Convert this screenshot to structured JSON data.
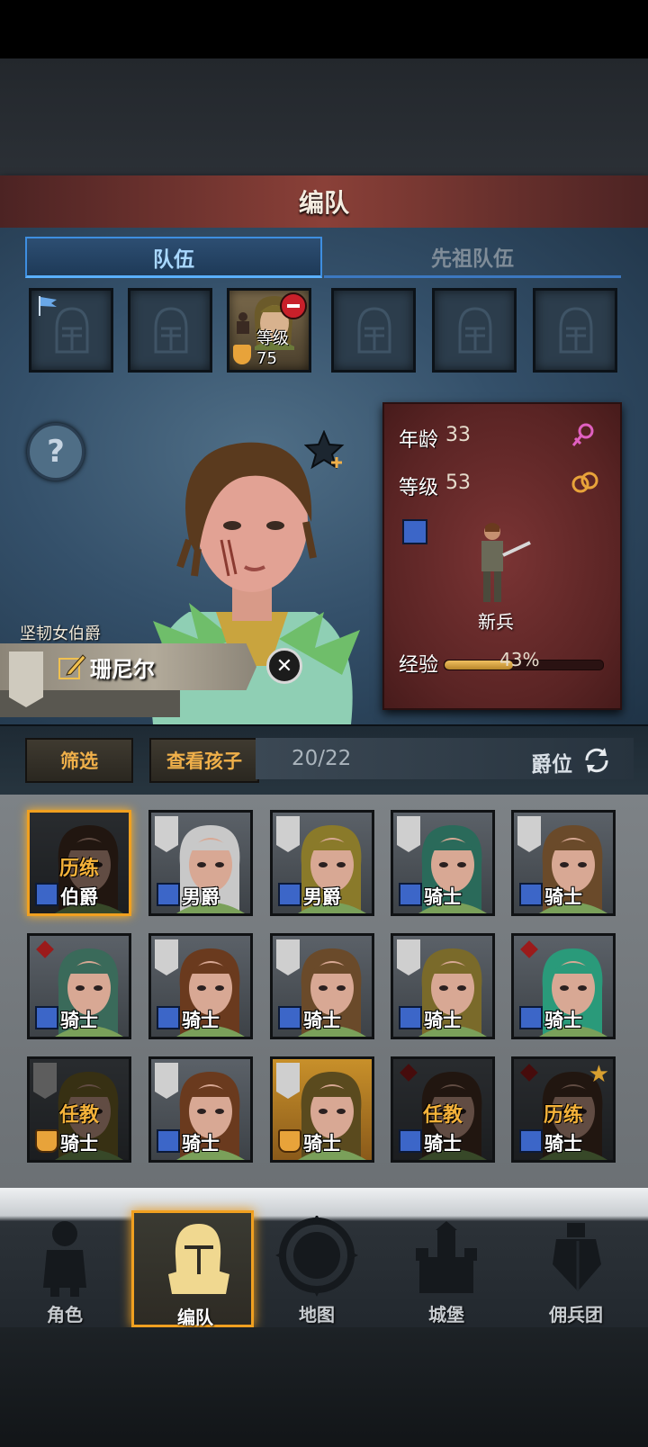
{
  "header": {
    "title": "编队"
  },
  "tabs": {
    "team": "队伍",
    "ancestor_team": "先祖队伍"
  },
  "team_slot": {
    "level_text": "等级75"
  },
  "hero": {
    "title": "坚韧女伯爵",
    "name": "珊尼尔",
    "age_label": "年龄",
    "age": "33",
    "level_label": "等级",
    "level": "53",
    "class": "新兵",
    "exp_label": "经验",
    "exp_percent": "43%",
    "exp_fraction": 0.43
  },
  "filter_bar": {
    "filter": "筛选",
    "view_children": "查看孩子",
    "count": "20/22",
    "rank": "爵位"
  },
  "roster": [
    {
      "label": "伯爵",
      "status": "历练"
    },
    {
      "label": "男爵",
      "status": ""
    },
    {
      "label": "男爵",
      "status": ""
    },
    {
      "label": "骑士",
      "status": ""
    },
    {
      "label": "骑士",
      "status": ""
    },
    {
      "label": "骑士",
      "status": ""
    },
    {
      "label": "骑士",
      "status": ""
    },
    {
      "label": "骑士",
      "status": ""
    },
    {
      "label": "骑士",
      "status": ""
    },
    {
      "label": "骑士",
      "status": ""
    },
    {
      "label": "骑士",
      "status": "任教"
    },
    {
      "label": "骑士",
      "status": ""
    },
    {
      "label": "骑士",
      "status": ""
    },
    {
      "label": "骑士",
      "status": "任教"
    },
    {
      "label": "骑士",
      "status": "历练"
    }
  ],
  "nav": {
    "character": "角色",
    "formation": "编队",
    "map": "地图",
    "castle": "城堡",
    "mercenary": "佣兵团"
  },
  "colors": {
    "accent_gold": "#f0a020",
    "tab_blue": "#5ab0ff",
    "status_orange": "#f5b23a"
  }
}
